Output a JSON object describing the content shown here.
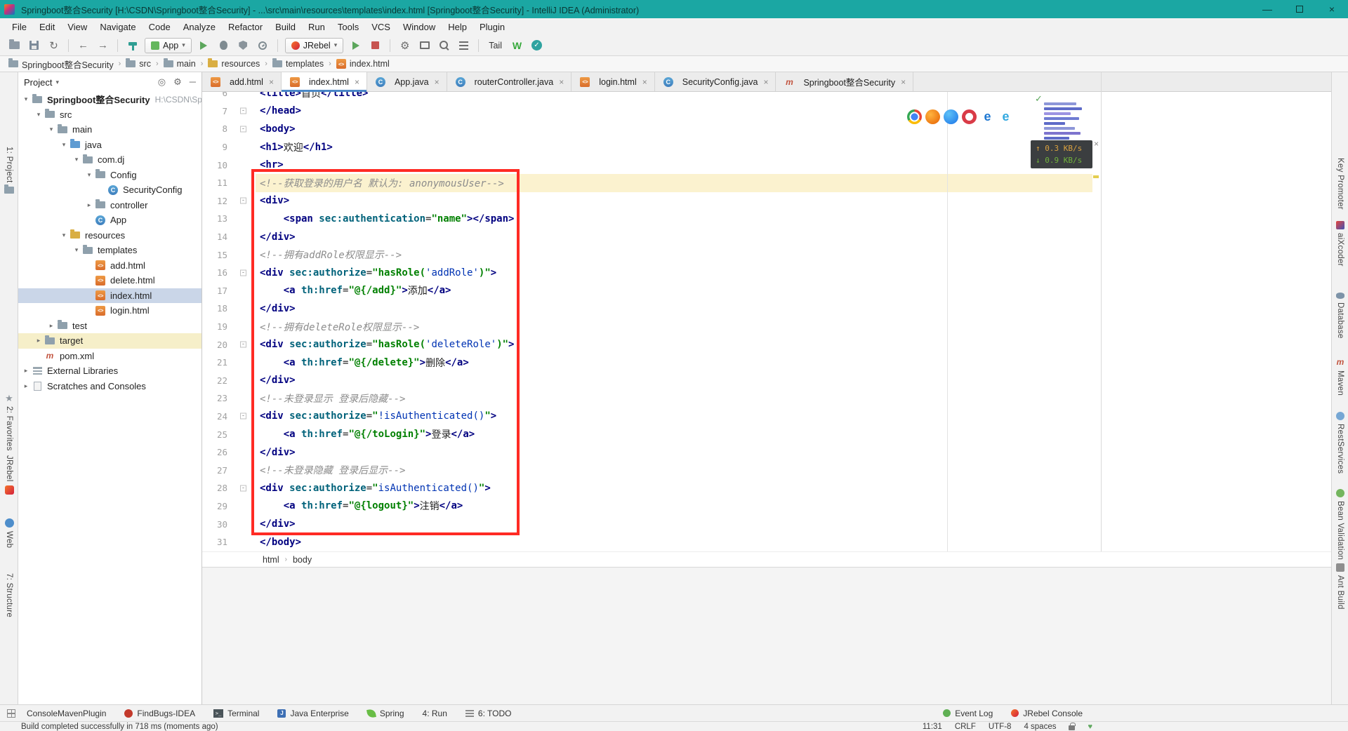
{
  "titlebar": {
    "title": "Springboot整合Security [H:\\CSDN\\Springboot整合Security] - ...\\src\\main\\resources\\templates\\index.html [Springboot整合Security] - IntelliJ IDEA (Administrator)"
  },
  "menubar": [
    "File",
    "Edit",
    "View",
    "Navigate",
    "Code",
    "Analyze",
    "Refactor",
    "Build",
    "Run",
    "Tools",
    "VCS",
    "Window",
    "Help",
    "Plugin"
  ],
  "toolbar": {
    "run_config_label": "App",
    "jrebel_label": "JRebel",
    "tail_label": "Tail"
  },
  "navbar": [
    {
      "label": "Springboot整合Security",
      "icon": "folder"
    },
    {
      "label": "src",
      "icon": "folder"
    },
    {
      "label": "main",
      "icon": "folder"
    },
    {
      "label": "resources",
      "icon": "folder-res"
    },
    {
      "label": "templates",
      "icon": "folder"
    },
    {
      "label": "index.html",
      "icon": "html"
    }
  ],
  "project": {
    "header": "Project",
    "tree": [
      {
        "label": "Springboot整合Security",
        "suffix": "H:\\CSDN\\Sp",
        "level": 0,
        "icon": "folder",
        "chevron": "open",
        "bold": true
      },
      {
        "label": "src",
        "level": 1,
        "icon": "folder",
        "chevron": "open"
      },
      {
        "label": "main",
        "level": 2,
        "icon": "folder",
        "chevron": "open"
      },
      {
        "label": "java",
        "level": 3,
        "icon": "folder-src",
        "chevron": "open"
      },
      {
        "label": "com.dj",
        "level": 4,
        "icon": "folder",
        "chevron": "open"
      },
      {
        "label": "Config",
        "level": 5,
        "icon": "folder",
        "chevron": "open"
      },
      {
        "label": "SecurityConfig",
        "level": 6,
        "icon": "class"
      },
      {
        "label": "controller",
        "level": 5,
        "icon": "folder",
        "chevron": "closed"
      },
      {
        "label": "App",
        "level": 5,
        "icon": "class"
      },
      {
        "label": "resources",
        "level": 3,
        "icon": "folder-res",
        "chevron": "open"
      },
      {
        "label": "templates",
        "level": 4,
        "icon": "folder",
        "chevron": "open"
      },
      {
        "label": "add.html",
        "level": 5,
        "icon": "html"
      },
      {
        "label": "delete.html",
        "level": 5,
        "icon": "html"
      },
      {
        "label": "index.html",
        "level": 5,
        "icon": "html",
        "selected": true
      },
      {
        "label": "login.html",
        "level": 5,
        "icon": "html"
      },
      {
        "label": "test",
        "level": 2,
        "icon": "folder",
        "chevron": "closed"
      },
      {
        "label": "target",
        "level": 1,
        "icon": "folder",
        "chevron": "closed",
        "highlight": true
      },
      {
        "label": "pom.xml",
        "level": 1,
        "icon": "maven"
      },
      {
        "label": "External Libraries",
        "level": 0,
        "icon": "libs",
        "chevron": "closed"
      },
      {
        "label": "Scratches and Consoles",
        "level": 0,
        "icon": "scratch",
        "chevron": "closed"
      }
    ]
  },
  "tabs": [
    {
      "label": "add.html",
      "icon": "html"
    },
    {
      "label": "index.html",
      "icon": "html",
      "active": true
    },
    {
      "label": "App.java",
      "icon": "class"
    },
    {
      "label": "routerController.java",
      "icon": "class"
    },
    {
      "label": "login.html",
      "icon": "html"
    },
    {
      "label": "SecurityConfig.java",
      "icon": "class"
    },
    {
      "label": "Springboot整合Security",
      "icon": "maven"
    }
  ],
  "editor": {
    "lines": [
      {
        "num": 6,
        "tokens": [
          [
            "tag",
            "<title>"
          ],
          [
            "txt",
            "首页"
          ],
          [
            "tag",
            "</title>"
          ]
        ]
      },
      {
        "num": 7,
        "tokens": [
          [
            "tag",
            "</head>"
          ]
        ],
        "fold": true
      },
      {
        "num": 8,
        "tokens": [
          [
            "tag",
            "<body>"
          ]
        ],
        "fold": true
      },
      {
        "num": 9,
        "tokens": [
          [
            "tag",
            "<h1>"
          ],
          [
            "txt",
            "欢迎"
          ],
          [
            "tag",
            "</h1>"
          ]
        ]
      },
      {
        "num": 10,
        "tokens": [
          [
            "tag",
            "<hr>"
          ]
        ]
      },
      {
        "num": 11,
        "tokens": [
          [
            "com",
            "<!--获取登录的用户名 默认为: anonymousUser-->"
          ]
        ],
        "current": true
      },
      {
        "num": 12,
        "tokens": [
          [
            "tag",
            "<div>"
          ]
        ],
        "fold": true
      },
      {
        "num": 13,
        "tokens": [
          [
            "txt",
            "    "
          ],
          [
            "tag",
            "<span "
          ],
          [
            "attr",
            "sec:authentication"
          ],
          [
            "txt",
            "="
          ],
          [
            "str",
            "\"name\""
          ],
          [
            "tag",
            "></span>"
          ]
        ]
      },
      {
        "num": 14,
        "tokens": [
          [
            "tag",
            "</div>"
          ]
        ]
      },
      {
        "num": 15,
        "tokens": [
          [
            "com",
            "<!--拥有addRole权限显示-->"
          ]
        ]
      },
      {
        "num": 16,
        "tokens": [
          [
            "tag",
            "<div "
          ],
          [
            "attr",
            "sec:authorize"
          ],
          [
            "txt",
            "="
          ],
          [
            "str",
            "\"hasRole("
          ],
          [
            "expr",
            "'addRole'"
          ],
          [
            "str",
            ")\""
          ],
          [
            "tag",
            ">"
          ]
        ],
        "fold": true
      },
      {
        "num": 17,
        "tokens": [
          [
            "txt",
            "    "
          ],
          [
            "tag",
            "<a "
          ],
          [
            "attr",
            "th:href"
          ],
          [
            "txt",
            "="
          ],
          [
            "str",
            "\"@{/add}\""
          ],
          [
            "tag",
            ">"
          ],
          [
            "txt",
            "添加"
          ],
          [
            "tag",
            "</a>"
          ]
        ]
      },
      {
        "num": 18,
        "tokens": [
          [
            "tag",
            "</div>"
          ]
        ]
      },
      {
        "num": 19,
        "tokens": [
          [
            "com",
            "<!--拥有deleteRole权限显示-->"
          ]
        ]
      },
      {
        "num": 20,
        "tokens": [
          [
            "tag",
            "<div "
          ],
          [
            "attr",
            "sec:authorize"
          ],
          [
            "txt",
            "="
          ],
          [
            "str",
            "\"hasRole("
          ],
          [
            "expr",
            "'deleteRole'"
          ],
          [
            "str",
            ")\""
          ],
          [
            "tag",
            ">"
          ]
        ],
        "fold": true
      },
      {
        "num": 21,
        "tokens": [
          [
            "txt",
            "    "
          ],
          [
            "tag",
            "<a "
          ],
          [
            "attr",
            "th:href"
          ],
          [
            "txt",
            "="
          ],
          [
            "str",
            "\"@{/delete}\""
          ],
          [
            "tag",
            ">"
          ],
          [
            "txt",
            "删除"
          ],
          [
            "tag",
            "</a>"
          ]
        ]
      },
      {
        "num": 22,
        "tokens": [
          [
            "tag",
            "</div>"
          ]
        ]
      },
      {
        "num": 23,
        "tokens": [
          [
            "com",
            "<!--未登录显示 登录后隐藏-->"
          ]
        ]
      },
      {
        "num": 24,
        "tokens": [
          [
            "tag",
            "<div "
          ],
          [
            "attr",
            "sec:authorize"
          ],
          [
            "txt",
            "="
          ],
          [
            "str",
            "\""
          ],
          [
            "expr",
            "!isAuthenticated()"
          ],
          [
            "str",
            "\""
          ],
          [
            "tag",
            ">"
          ]
        ],
        "fold": true
      },
      {
        "num": 25,
        "tokens": [
          [
            "txt",
            "    "
          ],
          [
            "tag",
            "<a "
          ],
          [
            "attr",
            "th:href"
          ],
          [
            "txt",
            "="
          ],
          [
            "str",
            "\"@{/toLogin}\""
          ],
          [
            "tag",
            ">"
          ],
          [
            "txt",
            "登录"
          ],
          [
            "tag",
            "</a>"
          ]
        ]
      },
      {
        "num": 26,
        "tokens": [
          [
            "tag",
            "</div>"
          ]
        ]
      },
      {
        "num": 27,
        "tokens": [
          [
            "com",
            "<!--未登录隐藏 登录后显示-->"
          ]
        ]
      },
      {
        "num": 28,
        "tokens": [
          [
            "tag",
            "<div "
          ],
          [
            "attr",
            "sec:authorize"
          ],
          [
            "txt",
            "="
          ],
          [
            "str",
            "\""
          ],
          [
            "expr",
            "isAuthenticated()"
          ],
          [
            "str",
            "\""
          ],
          [
            "tag",
            ">"
          ]
        ],
        "fold": true
      },
      {
        "num": 29,
        "tokens": [
          [
            "txt",
            "    "
          ],
          [
            "tag",
            "<a "
          ],
          [
            "attr",
            "th:href"
          ],
          [
            "txt",
            "="
          ],
          [
            "str",
            "\"@{logout}\""
          ],
          [
            "tag",
            ">"
          ],
          [
            "txt",
            "注销"
          ],
          [
            "tag",
            "</a>"
          ]
        ]
      },
      {
        "num": 30,
        "tokens": [
          [
            "tag",
            "</div>"
          ]
        ]
      },
      {
        "num": 31,
        "tokens": [
          [
            "tag",
            "</body>"
          ]
        ]
      }
    ],
    "breadcrumb": [
      "html",
      "body"
    ],
    "network_up": "0.3 KB/s",
    "network_down": "0.9 KB/s"
  },
  "left_stripe": [
    "1: Project",
    "2: Favorites",
    "JRebel",
    "Web",
    "7: Structure"
  ],
  "right_stripe": [
    "Key Promoter",
    "aiXcoder",
    "Database",
    "Maven",
    "RestServices",
    "Bean Validation",
    "Ant Build"
  ],
  "bottom_bar": {
    "left": [
      "ConsoleMavenPlugin",
      "FindBugs-IDEA",
      "Terminal",
      "Java Enterprise",
      "Spring",
      "4: Run",
      "6: TODO"
    ],
    "right": [
      "Event Log",
      "JRebel Console"
    ]
  },
  "statusbar": {
    "message": "Build completed successfully in 718 ms (moments ago)",
    "time": "11:31",
    "line_ending": "CRLF",
    "encoding": "UTF-8",
    "indent": "4 spaces"
  },
  "icons": {
    "caret_down": "▾",
    "tree_open": "▾",
    "tree_closed": "▸",
    "breadcrumb_sep": "›",
    "close": "×",
    "check": "✓",
    "up": "↑",
    "down": "↓",
    "back": "←",
    "forward": "→",
    "sync": "↻",
    "gear": "⚙",
    "star": "★",
    "minimize": "—",
    "heart": "♥",
    "locate": "◎",
    "hide": "─",
    "fold": "-",
    "browser_e": "e",
    "html_glyph": "<>",
    "class_glyph": "C",
    "maven_glyph": "m",
    "terminal_glyph": ">_",
    "jee_glyph": "J",
    "w_badge": "W"
  }
}
